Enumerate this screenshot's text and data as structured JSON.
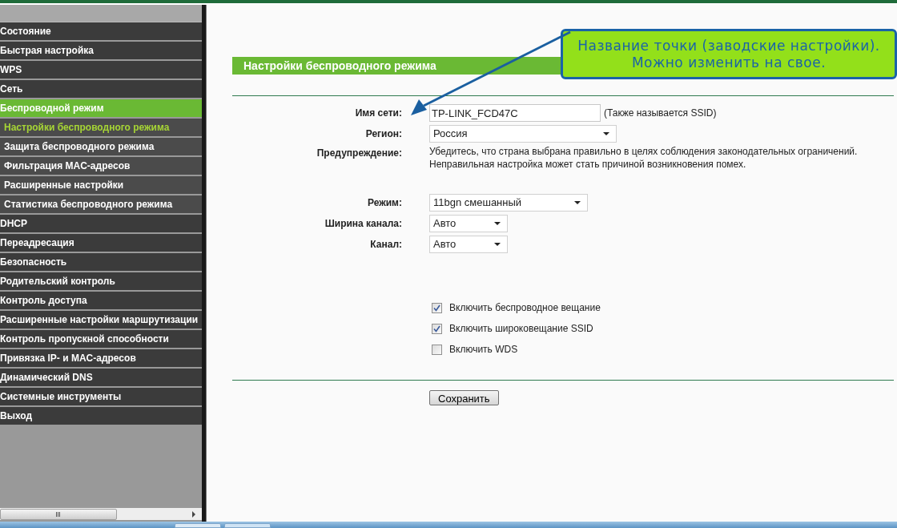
{
  "sidebar": {
    "items": [
      {
        "label": "Состояние",
        "kind": "main",
        "selected": false
      },
      {
        "label": "Быстрая настройка",
        "kind": "main",
        "selected": false
      },
      {
        "label": "WPS",
        "kind": "main",
        "selected": false
      },
      {
        "label": "Сеть",
        "kind": "main",
        "selected": false
      },
      {
        "label": "Беспроводной режим",
        "kind": "main",
        "selected": true
      },
      {
        "label": "Настройки беспроводного режима",
        "kind": "sub",
        "selected": true
      },
      {
        "label": "Защита беспроводного режима",
        "kind": "sub",
        "selected": false
      },
      {
        "label": "Фильтрация MAC-адресов",
        "kind": "sub",
        "selected": false
      },
      {
        "label": "Расширенные настройки",
        "kind": "sub",
        "selected": false
      },
      {
        "label": "Статистика беспроводного режима",
        "kind": "sub",
        "selected": false
      },
      {
        "label": "DHCP",
        "kind": "main",
        "selected": false
      },
      {
        "label": "Переадресация",
        "kind": "main",
        "selected": false
      },
      {
        "label": "Безопасность",
        "kind": "main",
        "selected": false
      },
      {
        "label": "Родительский контроль",
        "kind": "main",
        "selected": false
      },
      {
        "label": "Контроль доступа",
        "kind": "main",
        "selected": false
      },
      {
        "label": "Расширенные настройки маршрутизации",
        "kind": "main",
        "selected": false
      },
      {
        "label": "Контроль пропускной способности",
        "kind": "main",
        "selected": false
      },
      {
        "label": "Привязка IP- и MAC-адресов",
        "kind": "main",
        "selected": false
      },
      {
        "label": "Динамический DNS",
        "kind": "main",
        "selected": false
      },
      {
        "label": "Системные инструменты",
        "kind": "main",
        "selected": false
      },
      {
        "label": "Выход",
        "kind": "main",
        "selected": false
      }
    ]
  },
  "page_title": "Настройки беспроводного режима",
  "callout": {
    "lines": [
      "Название точки (заводские настройки).",
      "Можно изменить на свое."
    ]
  },
  "form": [
    {
      "kind": "text",
      "label": "Имя сети:",
      "value": "TP-LINK_FCD47C",
      "note": "(Также называется SSID)"
    },
    {
      "kind": "select",
      "label": "Регион:",
      "value": "Россия"
    },
    {
      "kind": "note",
      "label": "Предупреждение:",
      "value": "Убедитесь, что страна выбрана правильно в целях соблюдения законодательных ограничений. Неправильная настройка может стать причиной возникновения помех."
    },
    {
      "kind": "select",
      "label": "Режим:",
      "value": "11bgn смешанный"
    },
    {
      "kind": "select",
      "label": "Ширина канала:",
      "value": "Авто"
    },
    {
      "kind": "select",
      "label": "Канал:",
      "value": "Авто"
    }
  ],
  "checkboxes": [
    {
      "label": "Включить беспроводное вещание",
      "checked": true
    },
    {
      "label": "Включить широковещание SSID",
      "checked": true
    },
    {
      "label": "Включить WDS",
      "checked": false
    }
  ],
  "save_button": "Сохранить"
}
